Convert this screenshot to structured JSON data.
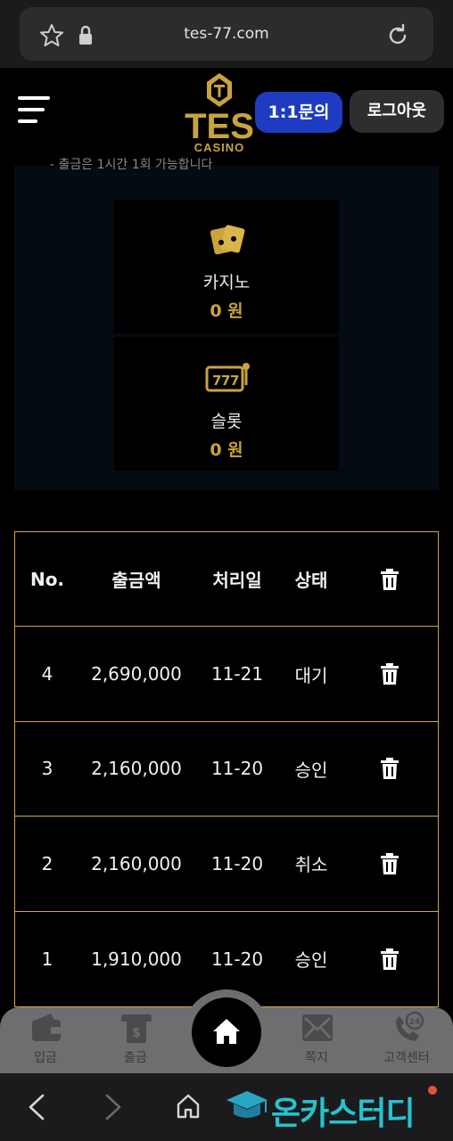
{
  "browser": {
    "url": "tes-77.com",
    "icons": [
      "star-icon",
      "lock-icon",
      "reload-icon"
    ]
  },
  "header": {
    "logo_text": "TES",
    "logo_sub": "CASINO",
    "inquiry_label": "1:1문의",
    "logout_label": "로그아웃"
  },
  "balances": {
    "peek_text": "- 출금은 1시간 1회 가능합니다",
    "casino": {
      "name": "카지노",
      "amount": "0 원",
      "icon": "cards-icon"
    },
    "slot": {
      "name": "슬롯",
      "amount": "0 원",
      "icon": "slot-machine-icon"
    }
  },
  "withdrawals": {
    "headers": {
      "no": "No.",
      "amount": "출금액",
      "date": "처리일",
      "status": "상태"
    },
    "rows": [
      {
        "no": "4",
        "amount": "2,690,000",
        "date": "11-21",
        "status": "대기"
      },
      {
        "no": "3",
        "amount": "2,160,000",
        "date": "11-20",
        "status": "승인"
      },
      {
        "no": "2",
        "amount": "2,160,000",
        "date": "11-20",
        "status": "취소"
      },
      {
        "no": "1",
        "amount": "1,910,000",
        "date": "11-20",
        "status": "승인"
      }
    ]
  },
  "bottom_nav": {
    "deposit": "입금",
    "withdraw": "출금",
    "message": "쪽지",
    "support": "고객센터"
  },
  "watermark": {
    "text": "온카스터디"
  },
  "colors": {
    "gold": "#c9a43a",
    "inquiry_blue": "#1e3cc2",
    "nav_gray": "#6e6e70"
  }
}
